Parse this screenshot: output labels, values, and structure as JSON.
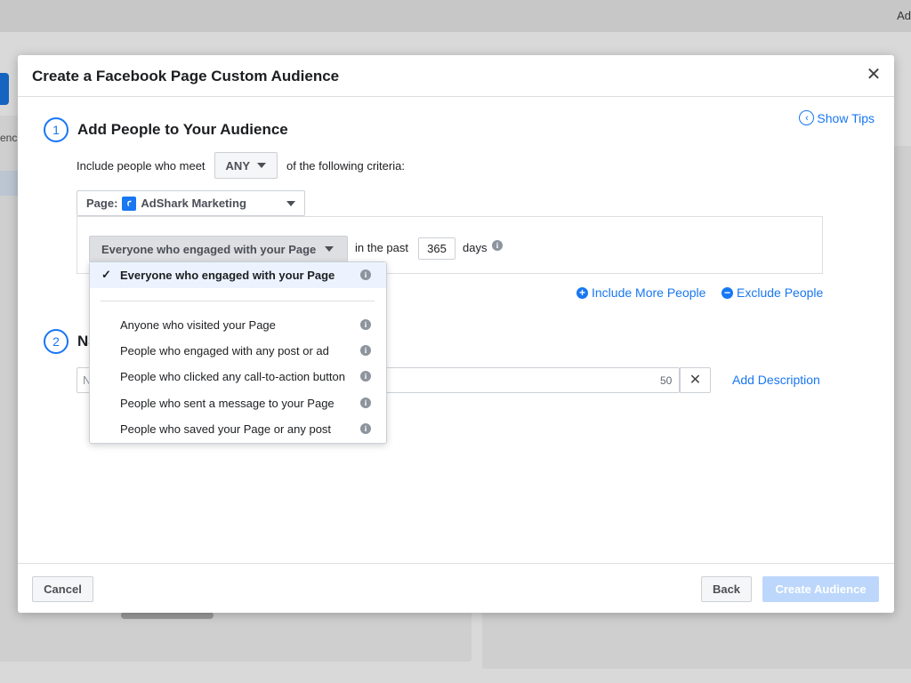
{
  "background": {
    "top_right_text": "Ad",
    "left_label": "enc"
  },
  "modal": {
    "title": "Create a Facebook Page Custom Audience",
    "close_icon": "close-icon"
  },
  "show_tips": {
    "label": "Show Tips",
    "icon": "chevron-left-circle-icon"
  },
  "step1": {
    "number": "1",
    "title": "Add People to Your Audience",
    "include_prefix": "Include people who meet",
    "match_value": "ANY",
    "include_suffix": "of the following criteria:",
    "page_label": "Page:",
    "page_logo_glyph": "ꜥ",
    "page_name": "AdShark Marketing",
    "engagement_selected": "Everyone who engaged with your Page",
    "in_the_past": "in the past",
    "days_value": "365",
    "days_label": "days",
    "include_more": "Include More People",
    "exclude": "Exclude People"
  },
  "dropdown": {
    "selected": "Everyone who engaged with your Page",
    "options": [
      "Anyone who visited your Page",
      "People who engaged with any post or ad",
      "People who clicked any call-to-action button",
      "People who sent a message to your Page",
      "People who saved your Page or any post"
    ]
  },
  "step2": {
    "number": "2",
    "title": "Name",
    "name_placeholder": "N",
    "char_count": "50",
    "add_description": "Add Description"
  },
  "footer": {
    "cancel": "Cancel",
    "back": "Back",
    "create": "Create Audience"
  },
  "colors": {
    "accent": "#1877f2",
    "create_disabled": "#bcd7fb",
    "selected_row": "#ecf3ff"
  }
}
